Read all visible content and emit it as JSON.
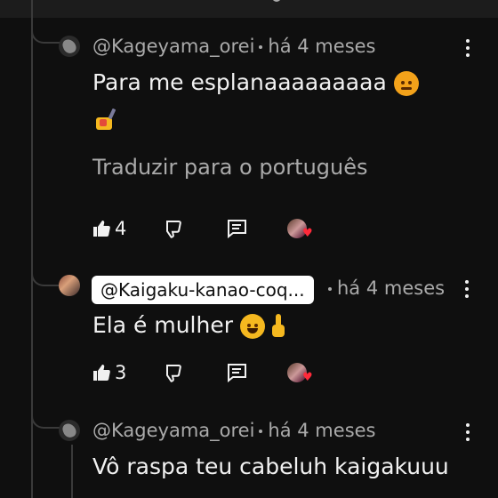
{
  "comments": [
    {
      "author": "@Kageyama_orei",
      "time": "há 4 meses",
      "text": "Para me esplanaaaaaaaaa",
      "translate": "Traduzir para o português",
      "likes": "4"
    },
    {
      "mention": "@Kaigaku-kanao-coq...",
      "time": "há 4 meses",
      "text": "Ela é mulher",
      "likes": "3"
    },
    {
      "author": "@Kageyama_orei",
      "time": "há 4 meses",
      "text": "Vô raspa teu cabeluh kaigakuuu"
    }
  ],
  "colors": {
    "background": "#0f0f0f",
    "text": "#f1f1f1",
    "secondary": "#aaaaaa",
    "heart": "#ff2a3a"
  },
  "icons": [
    "like-icon",
    "dislike-icon",
    "reply-icon",
    "more-vert-icon",
    "creator-heart-icon",
    "angry-face-emoji",
    "nail-polish-emoji",
    "grinning-face-emoji",
    "index-pointing-up-emoji"
  ]
}
